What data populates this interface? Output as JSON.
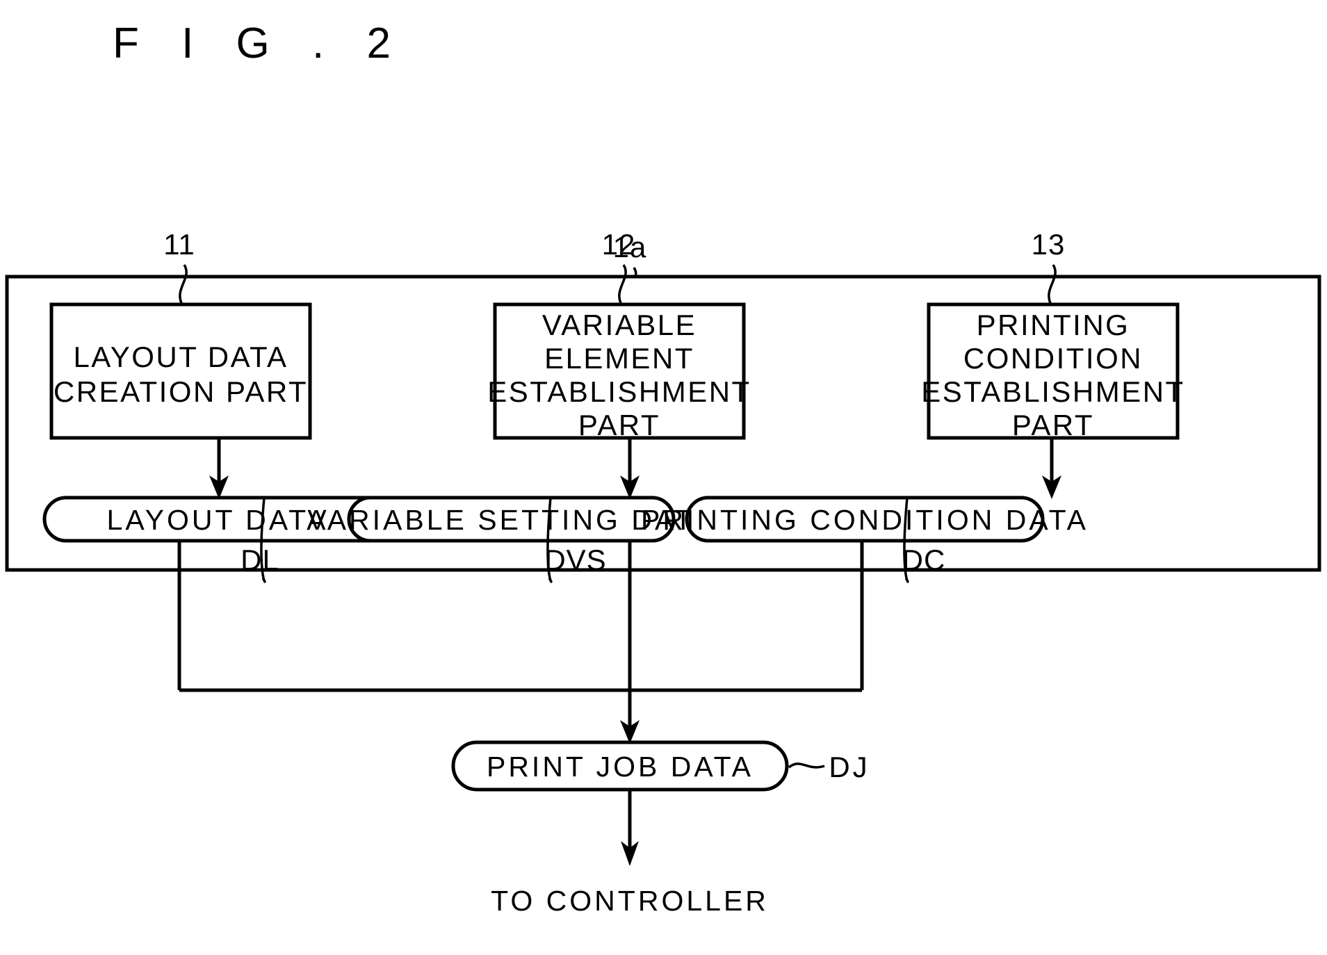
{
  "figure": {
    "title": "F I G . 2",
    "bottom_note": "TO CONTROLLER"
  },
  "outer_block": {
    "ref": "1a"
  },
  "process_boxes": [
    {
      "ref": "11",
      "lines": [
        "LAYOUT DATA",
        "CREATION PART"
      ]
    },
    {
      "ref": "12",
      "lines": [
        "VARIABLE",
        "ELEMENT",
        "ESTABLISHMENT",
        "PART"
      ]
    },
    {
      "ref": "13",
      "lines": [
        "PRINTING",
        "CONDITION",
        "ESTABLISHMENT",
        "PART"
      ]
    }
  ],
  "data_pills": [
    {
      "ref": "DL",
      "label": "LAYOUT DATA"
    },
    {
      "ref": "DVS",
      "label": "VARIABLE SETTING DATA"
    },
    {
      "ref": "DC",
      "label": "PRINTING CONDITION DATA"
    }
  ],
  "output_pill": {
    "ref": "DJ",
    "label": "PRINT JOB DATA"
  },
  "colors": {
    "ink": "#000000",
    "paper": "#ffffff"
  }
}
